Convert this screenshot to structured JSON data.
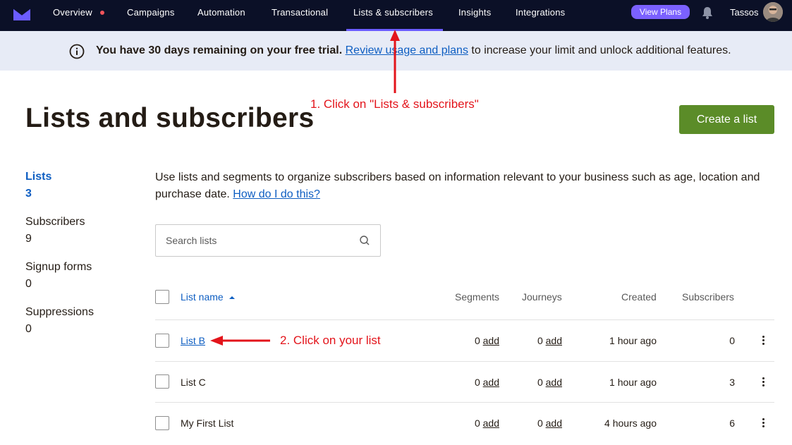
{
  "nav": {
    "items": [
      "Overview",
      "Campaigns",
      "Automation",
      "Transactional",
      "Lists & subscribers",
      "Insights",
      "Integrations"
    ],
    "active": "Lists & subscribers",
    "view_plans": "View Plans",
    "username": "Tassos",
    "colors": {
      "background": "#0b1027",
      "active_underline": "#6b5cff",
      "notification_dot": "#f2545b",
      "view_plans": "#7b61ff"
    }
  },
  "banner": {
    "bold_text": "You have 30 days remaining on your free trial.",
    "link_text": "Review usage and plans",
    "rest_text": " to increase your limit and unlock additional features.",
    "icon": "info-icon"
  },
  "page": {
    "title": "Lists and subscribers",
    "create_button": "Create a list",
    "create_color": "#5b8c28"
  },
  "annotations": {
    "step1": "1. Click on \"Lists & subscribers\"",
    "step2": "2. Click on your list",
    "color": "#e3141b"
  },
  "sidebar": [
    {
      "label": "Lists",
      "value": "3",
      "active": true
    },
    {
      "label": "Subscribers",
      "value": "9",
      "active": false
    },
    {
      "label": "Signup forms",
      "value": "0",
      "active": false
    },
    {
      "label": "Suppressions",
      "value": "0",
      "active": false
    }
  ],
  "intro": {
    "text": "Use lists and segments to organize subscribers based on information relevant to your business such as age, location and purchase date. ",
    "link": "How do I do this?"
  },
  "search": {
    "placeholder": "Search lists",
    "icon": "search-icon"
  },
  "table": {
    "headers": {
      "name": "List name",
      "segments": "Segments",
      "journeys": "Journeys",
      "created": "Created",
      "subscribers": "Subscribers"
    },
    "sort_icon": "caret-up-icon",
    "add_label": "add",
    "rows": [
      {
        "name": "List B",
        "segments": "0",
        "journeys": "0",
        "created": "1 hour ago",
        "subscribers": "0"
      },
      {
        "name": "List C",
        "segments": "0",
        "journeys": "0",
        "created": "1 hour ago",
        "subscribers": "3"
      },
      {
        "name": "My First List",
        "segments": "0",
        "journeys": "0",
        "created": "4 hours ago",
        "subscribers": "6"
      }
    ]
  }
}
